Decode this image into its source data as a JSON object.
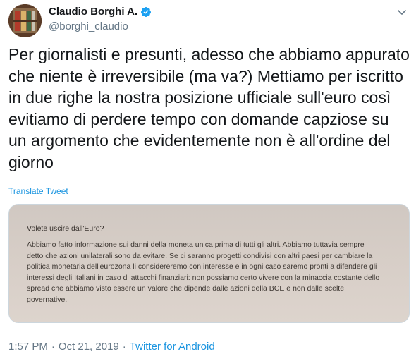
{
  "author": {
    "name": "Claudio Borghi A.",
    "handle": "@borghi_claudio",
    "verified_color": "#1da1f2"
  },
  "tweet": {
    "text": "Per giornalisti e presunti, adesso che abbiamo appurato\nche niente è irreversibile (ma va?) Mettiamo per iscritto\nin due righe la nostra posizione ufficiale sull'euro così\nevitiamo di perdere tempo con domande capziose su\nun argomento che evidentemente non è all'ordine del\ngiorno",
    "translate_label": "Translate Tweet"
  },
  "media": {
    "doc_title": "Volete uscire dall'Euro?",
    "doc_body": "Abbiamo fatto informazione sui danni della moneta unica prima di tutti gli altri. Abbiamo tuttavia sempre\ndetto che azioni unilaterali sono da evitare. Se ci saranno progetti condivisi con altri paesi per cambiare la\npolitica monetaria dell'eurozona li considereremo con interesse e in ogni caso saremo pronti a difendere gli\ninteressi degli Italiani in caso di attacchi finanziari: non possiamo certo vivere con la minaccia costante dello\nspread che abbiamo visto essere un valore che dipende dalle azioni della BCE e non dalle scelte\ngovernative."
  },
  "meta": {
    "time": "1:57 PM",
    "separator": "·",
    "date": "Oct 21, 2019",
    "source": "Twitter for Android"
  },
  "icons": {
    "verified": "verified-badge-icon",
    "more": "chevron-down-icon"
  }
}
